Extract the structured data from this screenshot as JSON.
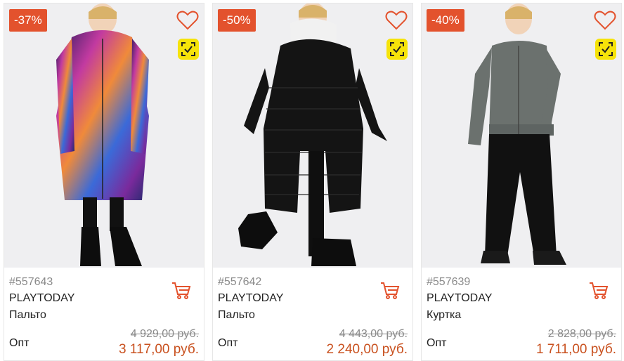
{
  "accent_color": "#e3522d",
  "price_color": "#c9511f",
  "products": [
    {
      "discount": "-37%",
      "sku": "#557643",
      "brand": "PLAYTODAY",
      "type": "Пальто",
      "opt_label": "Опт",
      "old_price": "4 929,00 руб.",
      "price": "3 117,00 руб."
    },
    {
      "discount": "-50%",
      "sku": "#557642",
      "brand": "PLAYTODAY",
      "type": "Пальто",
      "opt_label": "Опт",
      "old_price": "4 443,00 руб.",
      "price": "2 240,00 руб."
    },
    {
      "discount": "-40%",
      "sku": "#557639",
      "brand": "PLAYTODAY",
      "type": "Куртка",
      "opt_label": "Опт",
      "old_price": "2 828,00 руб.",
      "price": "1 711,00 руб."
    }
  ]
}
